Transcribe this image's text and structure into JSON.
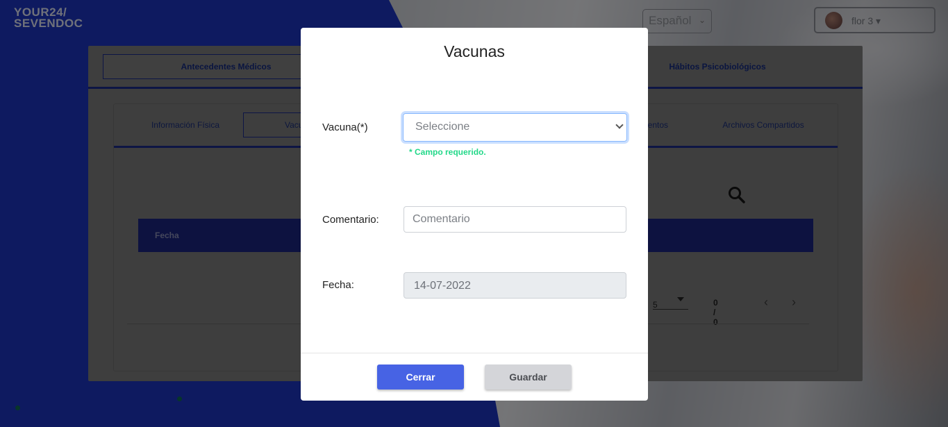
{
  "brand": {
    "line1": "YOUR24/",
    "line2": "SEVENDOC"
  },
  "header": {
    "language": "Español",
    "user_name": "flor 3 ▾"
  },
  "main_tabs": [
    {
      "label": "Antecedentes Médicos"
    },
    {
      "label": "Hábitos Psicobiológicos"
    }
  ],
  "sub_tabs": [
    {
      "label": "Información Física"
    },
    {
      "label": "Vacu"
    },
    {
      "label": "ientos"
    },
    {
      "label": "Archivos Compartidos"
    }
  ],
  "table": {
    "column_fecha": "Fecha"
  },
  "pager": {
    "page_size": "5",
    "range": "0 / 0",
    "prev": "‹",
    "next": "›"
  },
  "modal": {
    "title": "Vacunas",
    "vacuna_label": "Vacuna(*)",
    "vacuna_value": "Seleccione",
    "required_msg": "* Campo requerido.",
    "comentario_label": "Comentario:",
    "comentario_placeholder": "Comentario",
    "fecha_label": "Fecha:",
    "fecha_value": "14-07-2022",
    "close_label": "Cerrar",
    "save_label": "Guardar"
  },
  "colors": {
    "primary": "#4763e4",
    "required": "#22d889",
    "brand_blue": "#1d35c0"
  },
  "icons": [
    "search-icon",
    "chevron-down-icon",
    "chevron-left-icon",
    "chevron-right-icon"
  ]
}
